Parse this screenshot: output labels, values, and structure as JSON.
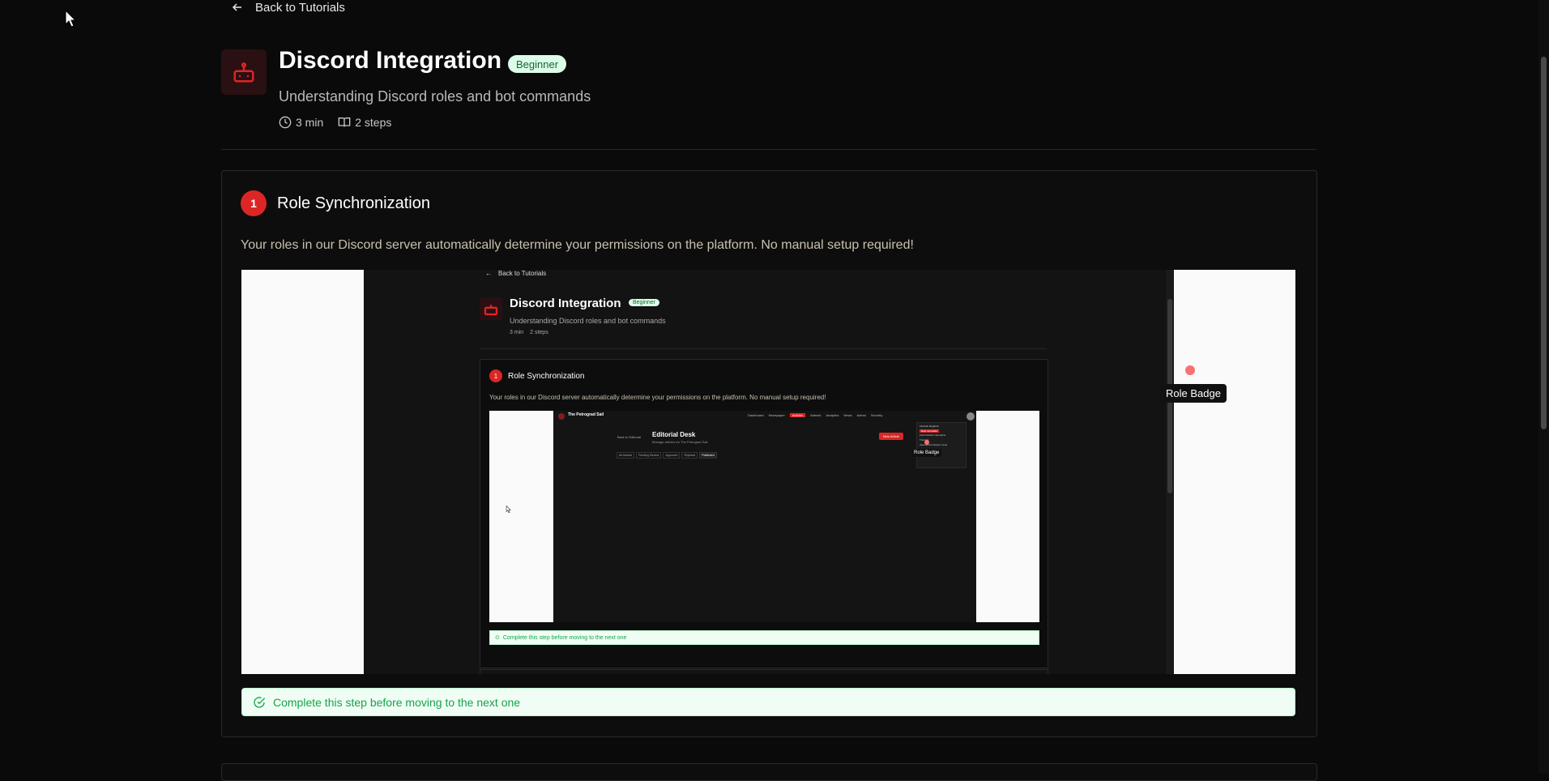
{
  "nav": {
    "back_label": "Back to Tutorials"
  },
  "tutorial": {
    "title": "Discord Integration",
    "level_badge": "Beginner",
    "subtitle": "Understanding Discord roles and bot commands",
    "duration": "3 min",
    "steps_count": "2 steps",
    "icon": "bot-icon"
  },
  "step": {
    "number": "1",
    "title": "Role Synchronization",
    "description": "Your roles in our Discord server automatically determine your permissions on the platform. No manual setup required!",
    "screenshot_tooltip": "Role Badge",
    "complete_notice": "Complete this step before moving to the next one"
  },
  "nested_preview": {
    "back_label": "Back to Tutorials",
    "title": "Discord Integration",
    "badge": "Beginner",
    "subtitle": "Understanding Discord roles and bot commands",
    "duration": "3 min",
    "steps_count": "2 steps",
    "step_number": "1",
    "step_title": "Role Synchronization",
    "step_description": "Your roles in our Discord server automatically determine your permissions on the platform. No manual setup required!",
    "complete_notice": "Complete this step before moving to the next one",
    "tooltip": "Role Badge",
    "app_name": "The Petrograd Sail",
    "page_title": "Editorial Desk",
    "page_subtitle": "Manage articles for The Petrograd Sail",
    "back_to_editorial": "Back to Editorial",
    "new_article": "New Article",
    "nav_items": [
      "Dashboard",
      "Newspaper",
      "Articles",
      "Artwork",
      "Analytics",
      "News",
      "Admin",
      "Security"
    ],
    "tabs": [
      "All Articles",
      "Pending Review",
      "Approved",
      "Rejected",
      "Published"
    ],
    "menu_user": "Lilimbek Mogilevb",
    "menu_role": "Role Journalist",
    "menu_items": [
      "Fetch Roblox Username",
      "Tutorials",
      "View as Permission Level",
      "Settings",
      "Log out"
    ]
  },
  "colors": {
    "accent_red": "#dc2626",
    "badge_green_bg": "#dcfce7",
    "badge_green_text": "#166534",
    "success_text": "#16a34a"
  }
}
